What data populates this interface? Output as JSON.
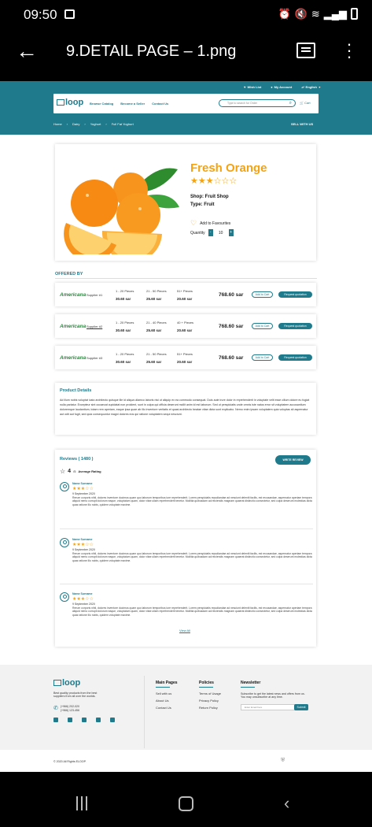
{
  "status": {
    "time": "09:50"
  },
  "viewer": {
    "file_name": "9.DETAIL PAGE – 1.png"
  },
  "header": {
    "wishlist": "Wish List",
    "account": "My Account",
    "language": "English",
    "logo_text": "loop",
    "nav": [
      "Browse Catalog",
      "Become a Seller",
      "Contact Us"
    ],
    "search_placeholder": "Type to search for Order",
    "cart": "Cart",
    "breadcrumb": [
      "Home",
      "Dairy",
      "Yoghurt",
      "Full Fat Yoghurt"
    ],
    "sell_with_us": "SELL WITH US"
  },
  "product": {
    "title": "Fresh Orange",
    "stars_filled": "★★★",
    "stars_empty": "☆☆☆",
    "shop": "Shop: Fruit Shop",
    "type": "Type: Fruit",
    "favourite": "Add to Favourites",
    "quantity_label": "Quantity",
    "quantity": "10",
    "minus": "-",
    "plus": "+"
  },
  "offered_by": {
    "heading": "OFFERED BY",
    "offers": [
      {
        "logo": "Americana",
        "supplier": "Supplier #1",
        "tiers": [
          {
            "range": "1 - 20 Pieces",
            "price": "30.60 sar"
          },
          {
            "range": "21 - 50 Pieces",
            "price": "25.60 sar"
          },
          {
            "range": "51+ Pieces",
            "price": "20.60 sar"
          }
        ],
        "total": "768.60 sar",
        "add": "Add to Cart",
        "quote": "Request quotation"
      },
      {
        "logo": "Americana",
        "supplier": "Supplier #2",
        "tiers": [
          {
            "range": "1 - 20 Pieces",
            "price": "30.60 sar"
          },
          {
            "range": "21 - 40 Pieces",
            "price": "25.60 sar"
          },
          {
            "range": "40 + Pieces",
            "price": "20.60 sar"
          }
        ],
        "total": "768.60 sar",
        "add": "Add to Cart",
        "quote": "Request quotation"
      },
      {
        "logo": "Americana",
        "supplier": "Supplier #3",
        "tiers": [
          {
            "range": "1 - 20 Pieces",
            "price": "30.60 sar"
          },
          {
            "range": "21 - 50 Pieces",
            "price": "25.60 sar"
          },
          {
            "range": "51+ Pieces",
            "price": "20.60 sar"
          }
        ],
        "total": "768.60 sar",
        "add": "Add to Cart",
        "quote": "Request quotation"
      }
    ]
  },
  "details": {
    "heading": "Product Details",
    "text": "Ad illum nobis voluptat iusto architecto quisque ille id aliqua ullamco laboris nisi ut aliquip ex ea commodo consequat. Duis aute irure dolor in reprehenderit in voluptate velit esse cillum dolore eu fugiat nulla pariatur. Excepteur sint occaecat cupidatat non proident, sunt in culpa qui officia deserunt mollit anim id est laborum. Sed ut perspiciatis unde omnis iste natus error sit voluptatem accusantium doloremque laudantium, totam rem aperiam, eaque ipsa quae ab illo inventore veritatis et quasi architecto beatae vitae dicta sunt explicabo. Nemo enim ipsam voluptatem quia voluptas sit aspernatur aut odit aut fugit, sed quia consequuntur magni dolores eos qui ratione voluptatem sequi nesciunt."
  },
  "reviews": {
    "heading": "Reviews ( 1480 )",
    "write": "WRITE REVIEW",
    "avg": "4",
    "avg_of": "/5",
    "avg_label": "Average Rating",
    "view_all": "View All",
    "items": [
      {
        "name": "Name Surname",
        "stars_filled": "★★★",
        "stars_empty": "☆☆",
        "date": "9 September 2020",
        "text": "Rerum corporis nihil, dolores inventore ducimus quam quo laborum temporibus iure reprehenderit. Lorem perspiciatis repudiandae ad nesciunt deleniti facilis, est recusandae, aspernatur aperiam tempora aliquid nemo corrupti dolorum eaque, voluptatum quam, dolor vitae ullam reprehenderit tenetur. Mollitia quibusdam ad reiciendis magnam quaerat distinctio consectetur, sed culpa deserunt molestias dicta quas ratione illo nobis, quidem voluptate maxime."
      },
      {
        "name": "Name Surname",
        "stars_filled": "★★★",
        "stars_empty": "☆☆",
        "date": "9 September 2020",
        "text": "Rerum corporis nihil, dolores inventore ducimus quam quo laborum temporibus iure reprehenderit. Lorem perspiciatis repudiandae ad nesciunt deleniti facilis, est recusandae, aspernatur aperiam tempora aliquid nemo corrupti dolorum eaque, voluptatum quam, dolor vitae ullam reprehenderit tenetur. Mollitia quibusdam ad reiciendis magnam quaerat distinctio consectetur, sed culpa deserunt molestias dicta quas ratione illo nobis, quidem voluptate maxime."
      },
      {
        "name": "Name Surname",
        "stars_filled": "★★★",
        "stars_empty": "☆☆",
        "date": "9 September 2020",
        "text": "Rerum corporis nihil, dolores inventore ducimus quam quo laborum temporibus iure reprehenderit. Lorem perspiciatis repudiandae ad nesciunt deleniti facilis, est recusandae, aspernatur aperiam tempora aliquid nemo corrupti dolorum eaque, voluptatum quam, dolor vitae ullam reprehenderit tenetur. Mollitia quibusdam ad reiciendis magnam quaerat distinctio consectetur, sed culpa deserunt molestias dicta quas ratione illo nobis, quidem voluptate maxime."
      }
    ]
  },
  "footer": {
    "logo_text": "loop",
    "desc": "Best quality products from the best suppliers from all over the worlds.",
    "phone1": "(+966) 202-020",
    "phone2": "(+966) 123-456",
    "main_pages": {
      "heading": "Main Pages",
      "links": [
        "Sell with us",
        "About Us",
        "Contact Us"
      ]
    },
    "policies": {
      "heading": "Policies",
      "links": [
        "Terms of Usage",
        "Privacy Policy",
        "Return Policy"
      ]
    },
    "newsletter": {
      "heading": "Newsletter",
      "text": "Subscribe to get the latest news and offers from us. You may unsubscribe at any time.",
      "placeholder": "Enter Email here",
      "button": "Submit"
    },
    "copyright": "© 2020 All Rights ELOOP."
  },
  "colors": {
    "brand": "#1f7a8c",
    "accent": "#f5a30f"
  }
}
